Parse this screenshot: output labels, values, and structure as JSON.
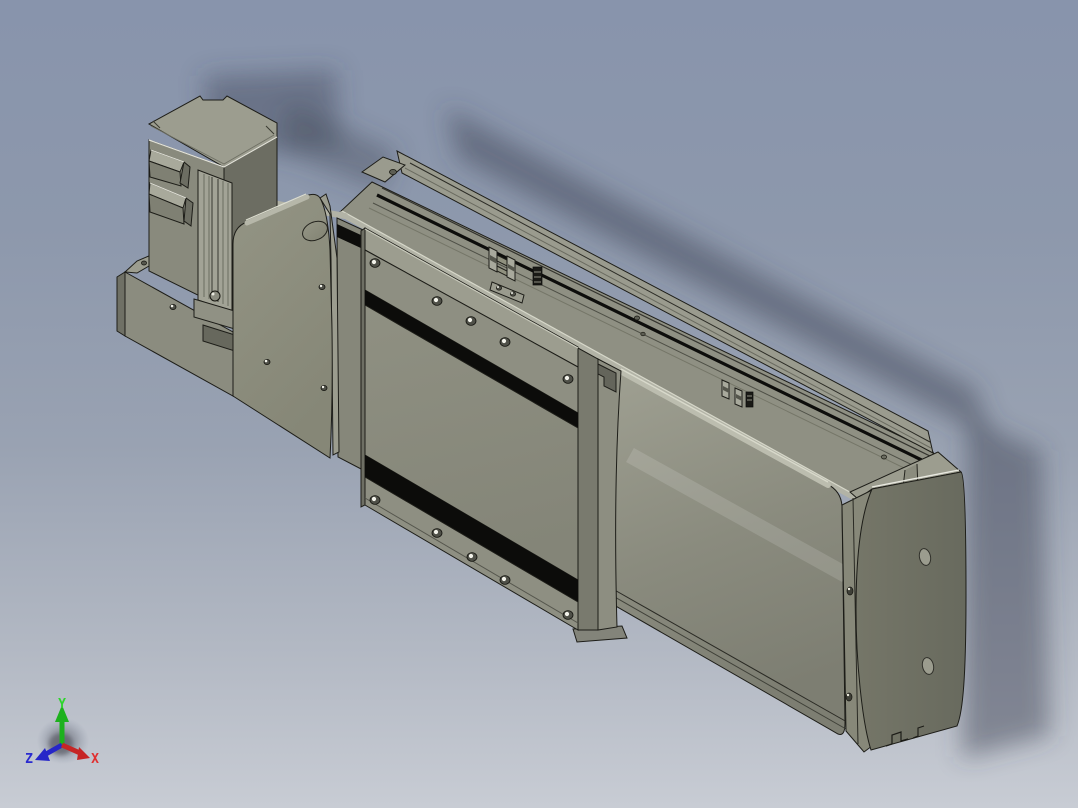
{
  "viewport": {
    "kind": "cad-3d-viewport",
    "background_top_color": "#8894ac",
    "background_bottom_color": "#c8ccd4",
    "cast_shadow_color": "#3e4656"
  },
  "model": {
    "name": "linear-actuator-3d-model",
    "top_face_color": "#9c9d8f",
    "front_face_color": "#8b8c7f",
    "side_face_color": "#6c6d62",
    "end_face_color": "#6e6f64",
    "seal_stripe_color": "#0c0c0a",
    "edge_highlight_color": "#b4b5a8",
    "outline_color": "#1d1d18"
  },
  "triad": {
    "x_label": "X",
    "y_label": "Y",
    "z_label": "Z",
    "x_color": "#e03030",
    "y_color": "#2dd52d",
    "z_color": "#2a2ad0",
    "x_arrow_color": "#c62525",
    "y_arrow_color": "#1db11d",
    "z_arrow_color": "#2626c8"
  }
}
